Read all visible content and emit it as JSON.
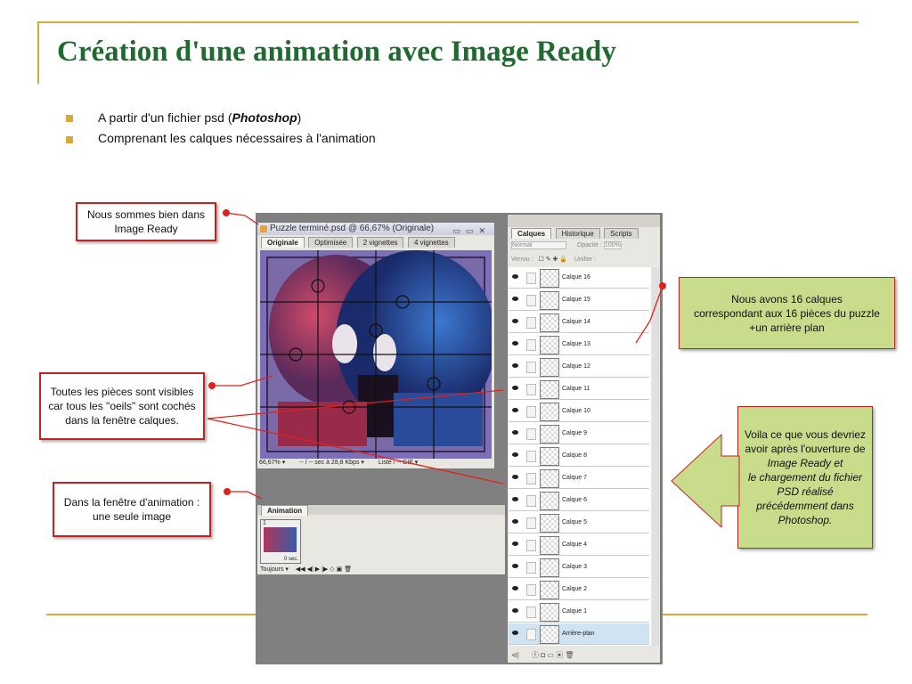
{
  "slide": {
    "title": "Création d'une animation avec  Image Ready",
    "bullets": [
      {
        "pre": "A partir d'un fichier psd (",
        "em": "Photoshop",
        "post": ")"
      },
      {
        "text": "Comprenant les calques nécessaires à l'animation"
      }
    ],
    "callouts": {
      "image_ready": "Nous sommes  bien dans Image Ready",
      "eyes": "Toutes les pièces sont visibles car tous les \"oeils\" sont cochés dans la fenêtre calques.",
      "animation": "Dans la fenêtre d'animation : une seule image",
      "layers": [
        "Nous avons 16 calques",
        "correspondant aux 16 pièces du puzzle",
        "+un arrière plan"
      ],
      "result": {
        "line1": "Voila ce que vous devriez avoir après l'ouverture de",
        "line2": "Image Ready et",
        "line3": "le chargement du fichier PSD réalisé précédemment dans Photoshop."
      }
    },
    "colors": {
      "title": "#1f6b2f",
      "accent": "#d8a93a",
      "callout_border": "#c6221e",
      "callout_green": "#c9dc8c"
    }
  },
  "screenshot": {
    "doc_window": {
      "title": "Puzzle terminé.psd @ 66,67% (Originale)",
      "tabs": [
        "Originale",
        "Optimisée",
        "2 vignettes",
        "4 vignettes"
      ],
      "status": {
        "zoom": "66,67%",
        "speed": "-- / -- sec à 28,8 Kbps",
        "size": "Liste / -- GIF"
      }
    },
    "animation_panel": {
      "tab": "Animation",
      "frame_number": "1",
      "frame_delay": "0 sec.",
      "loop": "Toujours"
    },
    "layers_panel": {
      "tabs": [
        "Calques",
        "Historique",
        "Scripts"
      ],
      "blend_mode": "Normal",
      "opacity_label": "Opacité :",
      "opacity_value": "100%",
      "lock_label": "Verrou :",
      "fill_label": "Unifier :",
      "layers": [
        "Calque 16",
        "Calque 15",
        "Calque 14",
        "Calque 13",
        "Calque 12",
        "Calque 11",
        "Calque 10",
        "Calque 9",
        "Calque 8",
        "Calque 7",
        "Calque 6",
        "Calque 5",
        "Calque 4",
        "Calque 3",
        "Calque 2",
        "Calque 1",
        "Arrière-plan"
      ]
    }
  }
}
